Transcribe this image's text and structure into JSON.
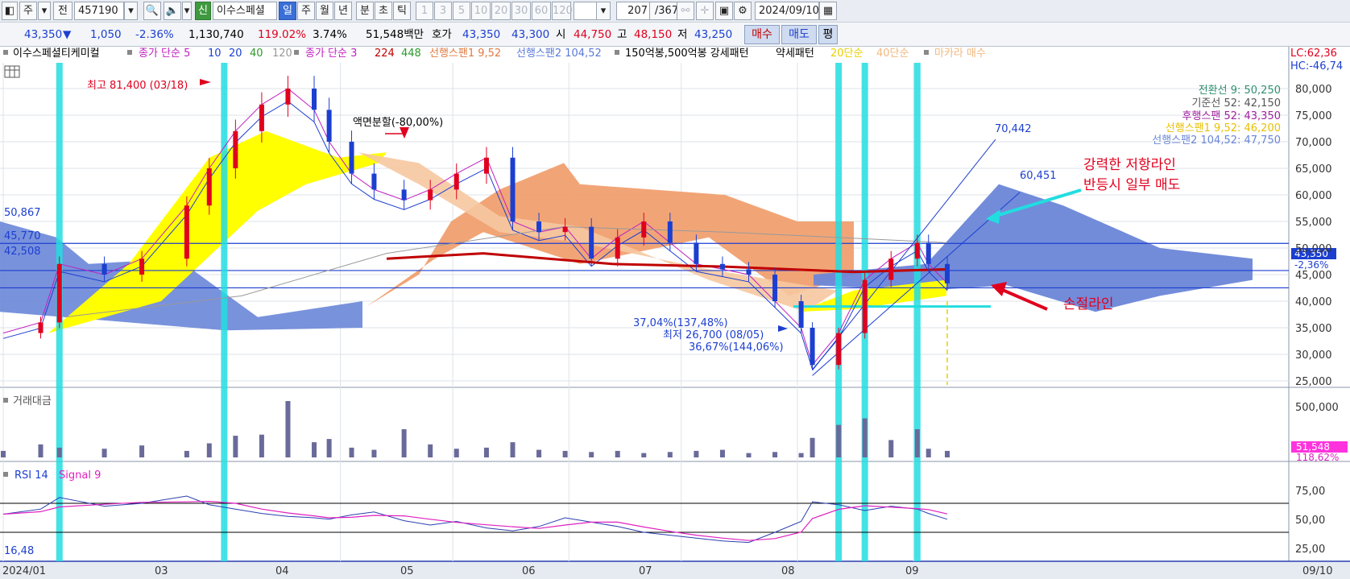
{
  "toolbar": {
    "icon_left": "chart-window-icon",
    "period_button": "주",
    "prev_button": "전",
    "code": "457190",
    "search_icon": "search-icon",
    "speaker_icon": "speaker-icon",
    "new_badge": "신",
    "stock_name": "이수스페셜",
    "periods": [
      "일",
      "주",
      "월",
      "년",
      "분",
      "초",
      "틱"
    ],
    "active_period": "일",
    "intervals": [
      "1",
      "3",
      "5",
      "10",
      "20",
      "30",
      "60",
      "120"
    ],
    "count": "207",
    "total": "/367",
    "date": "2024/09/10",
    "calendar_icon": "calendar-icon",
    "settings_icon": "gear-icon",
    "save_icon": "save-icon"
  },
  "quote": {
    "price": "43,350",
    "change_arrow": "▼",
    "change": "1,050",
    "change_pct": "-2.36%",
    "volume": "1,130,740",
    "volume_ratio": "119.02%",
    "turnover": "3.74%",
    "amount": "51,548백만",
    "bid_label": "호가",
    "ask_price": "43,350",
    "bid_price": "43,300",
    "open_label": "시",
    "open": "44,750",
    "high_label": "고",
    "high": "48,150",
    "low_label": "저",
    "low": "43,250",
    "buy_button": "매수",
    "sell_button": "매도",
    "eval_button": "평"
  },
  "legend": {
    "name": "이수스페셜티케미컬",
    "ma_label": "종가 단순 5",
    "ma_periods": [
      "10",
      "20",
      "40",
      "120"
    ],
    "ma2_label": "종가 단순 3",
    "ma2_periods": [
      "224",
      "448"
    ],
    "span1": "선행스팬1 9,52",
    "span2": "선행스팬2 104,52",
    "pattern": "150억봉,500억봉 강세패턴",
    "weak": "약세패턴",
    "ma20": "20단순",
    "ma40": "40단순",
    "macarra": "마카라 매수",
    "lc": "LC:62,36",
    "hc": "HC:-46,74"
  },
  "ichimoku_legend": [
    {
      "text": "전환선 9: 50,250",
      "color": "#2f8f6f"
    },
    {
      "text": "기준선 52: 42,150",
      "color": "#555555"
    },
    {
      "text": "후행스팬 52: 43,350",
      "color": "#a020a0"
    },
    {
      "text": "선행스팬1 9,52: 46,200",
      "color": "#e8c000"
    },
    {
      "text": "선행스팬2 104,52: 47,750",
      "color": "#6a86d8"
    }
  ],
  "annotations": {
    "high": "최고 81,400 (03/18)",
    "split": "액면분할(-80,00%)",
    "low": "최저 26,700 (08/05)",
    "pct1": "37,04%(137,48%)",
    "pct2": "36,67%(144,06%)",
    "target1": "70,442",
    "target2": "60,451",
    "resistance1": "강력한 저항라인",
    "resistance2": "반등시 일부 매도",
    "stoploss": "손절라인",
    "hline1": "50,867",
    "hline2": "45,770",
    "hline3": "42,508",
    "price_box": "43,350",
    "price_pct": "-2,36%"
  },
  "volume_panel": {
    "title": "거래대금",
    "tick": "500,000",
    "box_value": "51,548",
    "box_pct": "118,62%"
  },
  "rsi_panel": {
    "title": "RSI 14",
    "signal": "Signal 9",
    "level": "16,48",
    "ticks": [
      "75,00",
      "50,00",
      "25,00"
    ]
  },
  "date_axis": {
    "labels": [
      "2024/01",
      "03",
      "04",
      "05",
      "06",
      "07",
      "08",
      "09"
    ],
    "current": "09/10"
  },
  "price_axis": {
    "ticks": [
      "80,000",
      "75,000",
      "70,000",
      "65,000",
      "60,000",
      "55,000",
      "50,000",
      "45,000",
      "40,000",
      "35,000",
      "30,000",
      "25,000"
    ]
  },
  "chart_data": {
    "type": "candlestick",
    "title": "이수스페셜티케미컬",
    "x": [
      "2024/01",
      "03",
      "04",
      "05",
      "06",
      "07",
      "08",
      "09"
    ],
    "close_series": {
      "name": "종가",
      "points": [
        [
          "01-02",
          34000
        ],
        [
          "01-12",
          36000
        ],
        [
          "01-17",
          47000
        ],
        [
          "01-29",
          45000
        ],
        [
          "02-08",
          48000
        ],
        [
          "02-20",
          58000
        ],
        [
          "02-26",
          65000
        ],
        [
          "03-04",
          72000
        ],
        [
          "03-11",
          77000
        ],
        [
          "03-18",
          80000
        ],
        [
          "03-25",
          76000
        ],
        [
          "03-29",
          70000
        ],
        [
          "04-04",
          64000
        ],
        [
          "04-10",
          61000
        ],
        [
          "04-18",
          59000
        ],
        [
          "04-25",
          61000
        ],
        [
          "05-02",
          64000
        ],
        [
          "05-10",
          67000
        ],
        [
          "05-17",
          55000
        ],
        [
          "05-24",
          53000
        ],
        [
          "05-31",
          54000
        ],
        [
          "06-07",
          48000
        ],
        [
          "06-14",
          52000
        ],
        [
          "06-21",
          55000
        ],
        [
          "06-28",
          51000
        ],
        [
          "07-05",
          47000
        ],
        [
          "07-12",
          46000
        ],
        [
          "07-19",
          45000
        ],
        [
          "07-26",
          40000
        ],
        [
          "08-02",
          35000
        ],
        [
          "08-05",
          28000
        ],
        [
          "08-12",
          34000
        ],
        [
          "08-19",
          44000
        ],
        [
          "08-26",
          48000
        ],
        [
          "09-02",
          51000
        ],
        [
          "09-05",
          47000
        ],
        [
          "09-10",
          43350
        ]
      ]
    },
    "volume_series": {
      "name": "거래대금",
      "values": [
        60,
        120,
        90,
        80,
        110,
        60,
        130,
        200,
        210,
        520,
        140,
        170,
        90,
        70,
        260,
        120,
        80,
        90,
        140,
        70,
        60,
        50,
        60,
        40,
        50,
        60,
        70,
        40,
        50,
        40,
        180,
        300,
        360,
        160,
        260,
        80,
        60
      ]
    },
    "rsi_series": {
      "name": "RSI 14",
      "values": [
        55,
        62,
        78,
        66,
        70,
        80,
        68,
        62,
        56,
        52,
        50,
        48,
        54,
        58,
        46,
        40,
        45,
        36,
        32,
        38,
        50,
        44,
        38,
        30,
        26,
        22,
        18,
        16,
        30,
        45,
        72,
        68,
        60,
        66,
        62,
        56,
        48
      ]
    },
    "ylim": [
      25000,
      80000
    ],
    "rsi_ylim": [
      0,
      100
    ]
  },
  "colors": {
    "up": "#e0001e",
    "down": "#1c3fd0",
    "cloud_bull": "#ffff00",
    "cloud_bear_1": "#f0a070",
    "cloud_bear_2": "#6a86d8",
    "highlight": "#22dde0",
    "rsi_line": "#2a3fb0",
    "signal_line": "#e020c0",
    "volume_bar": "#6a6a9a"
  }
}
